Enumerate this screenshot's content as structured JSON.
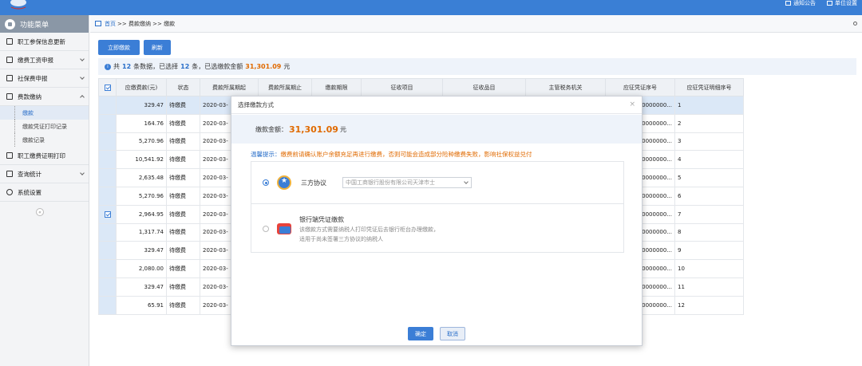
{
  "header": {
    "links": [
      "通知公告",
      "单位设置"
    ]
  },
  "sidebar": {
    "title": "功能菜单",
    "items": [
      {
        "label": "职工参保信息更新",
        "icon": "user-update-icon"
      },
      {
        "label": "缴费工资申报",
        "icon": "edit-icon"
      },
      {
        "label": "社保费申报",
        "icon": "doc-icon"
      },
      {
        "label": "费款缴纳",
        "icon": "wallet-icon"
      }
    ],
    "subitems": [
      "缴款",
      "缴款凭证打印记录",
      "缴款记录"
    ],
    "items2": [
      {
        "label": "职工缴费证明打印",
        "icon": "print-icon"
      },
      {
        "label": "查询统计",
        "icon": "chart-icon"
      },
      {
        "label": "系统设置",
        "icon": "gear-icon"
      }
    ]
  },
  "breadcrumb": {
    "home": "首页",
    "path": ">> 费款缴纳 >> 缴款"
  },
  "toolbar": {
    "pay_label": "立即缴款",
    "refresh_label": "刷新"
  },
  "info": {
    "prefix": "共",
    "total": "12",
    "mid": "条数据，已选择",
    "selected": "12",
    "mid2": "条，已选缴款金额",
    "amount": "31,301.09",
    "unit": "元"
  },
  "table": {
    "headers": [
      "应缴费款(元)",
      "状态",
      "费款所属期起",
      "费款所属期止",
      "缴款期限",
      "征收项目",
      "征收品目",
      "主管税务机关",
      "应征凭证序号",
      "应征凭证明细序号"
    ],
    "rows": [
      {
        "amount": "329.47",
        "status": "待缴费",
        "start": "2020-03-",
        "voucher": "0000000...",
        "seq": "1"
      },
      {
        "amount": "164.76",
        "status": "待缴费",
        "start": "2020-03-",
        "voucher": "0000000...",
        "seq": "2"
      },
      {
        "amount": "5,270.96",
        "status": "待缴费",
        "start": "2020-03-",
        "voucher": "0000000...",
        "seq": "3"
      },
      {
        "amount": "10,541.92",
        "status": "待缴费",
        "start": "2020-03-",
        "voucher": "0000000...",
        "seq": "4"
      },
      {
        "amount": "2,635.48",
        "status": "待缴费",
        "start": "2020-03-",
        "voucher": "0000000...",
        "seq": "5"
      },
      {
        "amount": "5,270.96",
        "status": "待缴费",
        "start": "2020-03-",
        "voucher": "0000000...",
        "seq": "6"
      },
      {
        "amount": "2,964.95",
        "status": "待缴费",
        "start": "2020-03-",
        "voucher": "0000000...",
        "seq": "7"
      },
      {
        "amount": "1,317.74",
        "status": "待缴费",
        "start": "2020-03-",
        "voucher": "0000000...",
        "seq": "8"
      },
      {
        "amount": "329.47",
        "status": "待缴费",
        "start": "2020-03-",
        "voucher": "0000000...",
        "seq": "9"
      },
      {
        "amount": "2,080.00",
        "status": "待缴费",
        "start": "2020-03-",
        "voucher": "0000000...",
        "seq": "10"
      },
      {
        "amount": "329.47",
        "status": "待缴费",
        "start": "2020-03-",
        "voucher": "0000000...",
        "seq": "11"
      },
      {
        "amount": "65.91",
        "status": "待缴费",
        "start": "2020-03-",
        "voucher": "0000000...",
        "seq": "12"
      }
    ]
  },
  "modal": {
    "title": "选择缴款方式",
    "amount_label": "缴款金额：",
    "amount": "31,301.09",
    "amount_unit": "元",
    "tip_label": "温馨提示：",
    "tip_text": "缴费前请确认账户余额充足再进行缴费，否则可能会造成部分险种缴费失败，影响社保权益兑付",
    "option1_label": "三方协议",
    "option1_bank": "中国工商银行股份有限公司天津市士",
    "option2_label": "银行端凭证缴款",
    "option2_desc1": "该缴款方式需要纳税人打印凭证后去银行柜台办理缴款，",
    "option2_desc2": "适用于尚未签署三方协议的纳税人",
    "ok_label": "确定",
    "cancel_label": "取消"
  },
  "colors": {
    "accent": "#3b7ed6",
    "highlight": "#e06a00"
  }
}
